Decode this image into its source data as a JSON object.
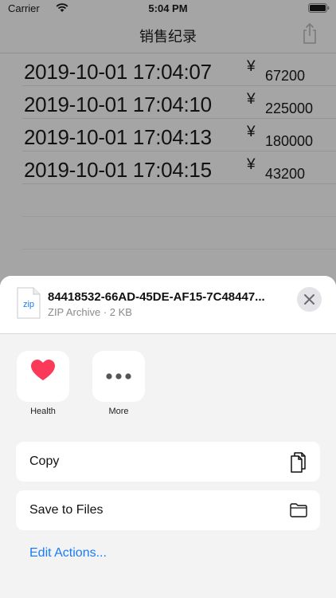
{
  "status_bar": {
    "carrier": "Carrier",
    "time": "5:04 PM"
  },
  "nav": {
    "title": "销售纪录"
  },
  "sales": [
    {
      "date": "2019-10-01 17:04:07",
      "currency": "¥",
      "amount": "67200"
    },
    {
      "date": "2019-10-01 17:04:10",
      "currency": "¥",
      "amount": "225000"
    },
    {
      "date": "2019-10-01 17:04:13",
      "currency": "¥",
      "amount": "180000"
    },
    {
      "date": "2019-10-01 17:04:15",
      "currency": "¥",
      "amount": "43200"
    }
  ],
  "share_sheet": {
    "file_icon_label": "zip",
    "file_name": "84418532-66AD-45DE-AF15-7C48447...",
    "file_meta": "ZIP Archive · 2 KB",
    "apps": [
      {
        "label": "Health",
        "icon": "heart-icon"
      },
      {
        "label": "More",
        "icon": "more-dots-icon"
      }
    ],
    "actions": [
      {
        "label": "Copy",
        "icon": "copy-documents-icon"
      },
      {
        "label": "Save to Files",
        "icon": "folder-icon"
      }
    ],
    "edit_actions": "Edit Actions...",
    "colors": {
      "accent": "#1a7cf5",
      "health_heart": "#fb3a5a"
    }
  }
}
